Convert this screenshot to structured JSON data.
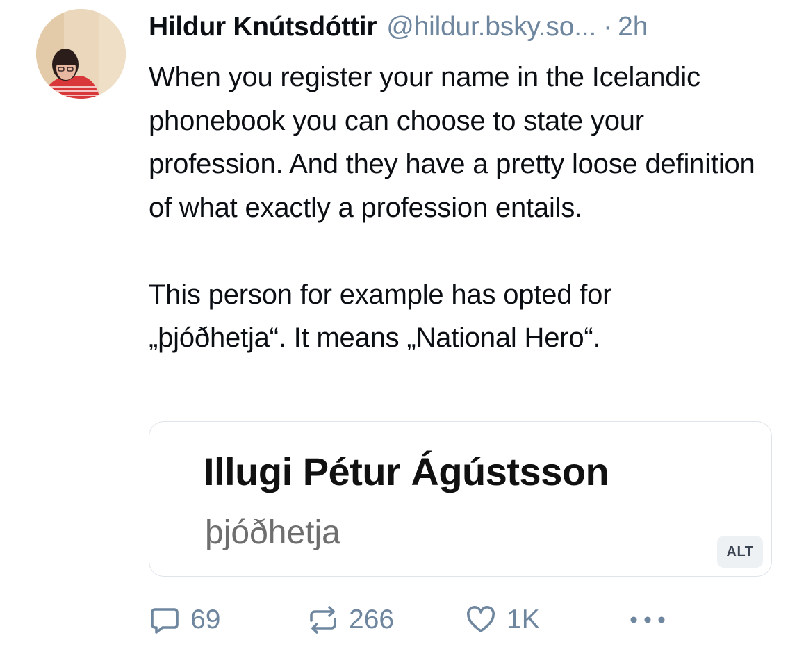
{
  "post": {
    "author_name": "Hildur Knútsdóttir",
    "handle": "@hildur.bsky.so...",
    "separator": "·",
    "time": "2h",
    "paragraph1": "When you register your name in the Icelandic phonebook you can choose to state your profession. And they have a pretty loose definition of what exactly a profession entails.",
    "paragraph2_line1": "This person for example has opted for",
    "paragraph2_line2": "„þjóðhetja“. It means „National Hero“."
  },
  "embed": {
    "name": "Illugi Pétur Ágústsson",
    "profession": "þjóðhetja",
    "alt_label": "ALT"
  },
  "actions": {
    "reply_count": "69",
    "repost_count": "266",
    "like_count": "1K",
    "more_icon": "more-dots-icon",
    "reply_icon": "reply-bubble-icon",
    "repost_icon": "repost-arrows-icon",
    "like_icon": "heart-icon"
  },
  "colors": {
    "text": "#0b0f14",
    "muted": "#6f869f",
    "border": "#dfe4ea"
  }
}
